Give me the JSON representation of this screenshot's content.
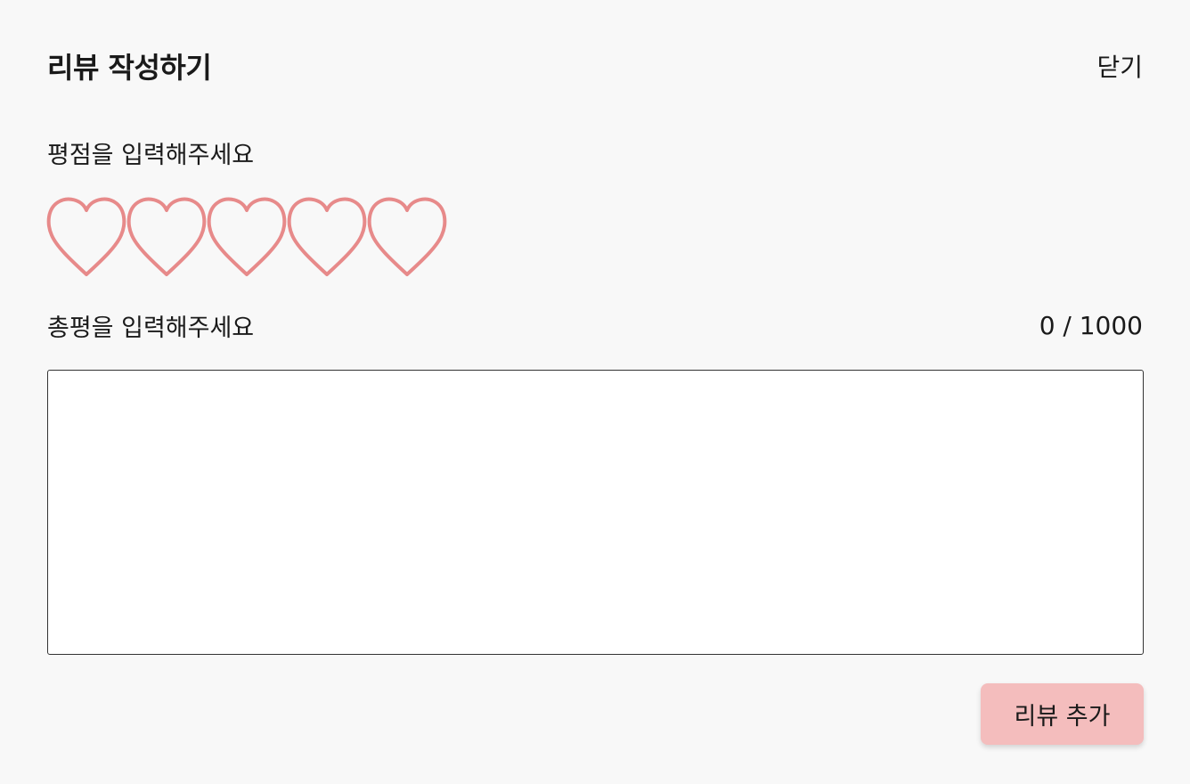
{
  "modal": {
    "title": "리뷰 작성하기",
    "close_label": "닫기"
  },
  "rating": {
    "label": "평점을 입력해주세요",
    "max": 5,
    "value": 0,
    "heart_color": "#e78a8a"
  },
  "review": {
    "label": "총평을 입력해주세요",
    "counter": "0 / 1000",
    "value": "",
    "placeholder": ""
  },
  "actions": {
    "submit_label": "리뷰 추가",
    "submit_color": "#f4bdbd"
  }
}
